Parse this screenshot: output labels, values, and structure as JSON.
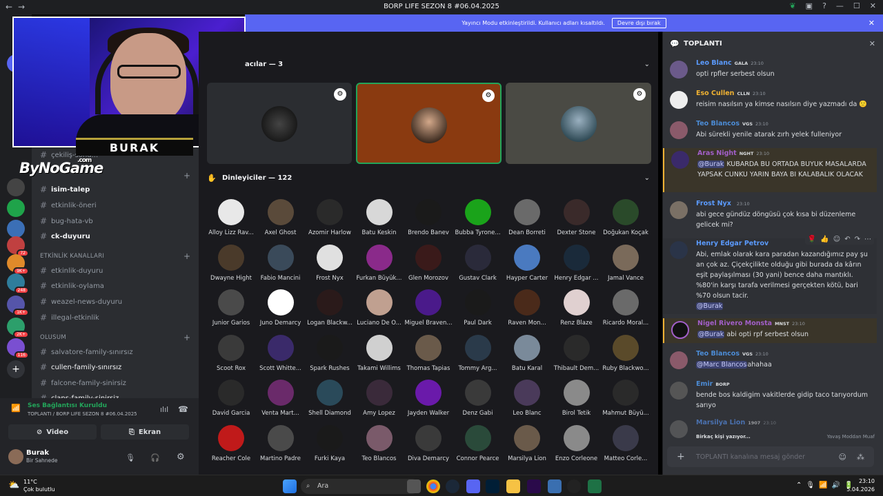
{
  "window": {
    "title": "BORP LIFE SEZON 8 #06.04.2025"
  },
  "banner": {
    "text": "Yayıncı Modu etkinleştirildi. Kullanıcı adları kısaltıldı.",
    "button": "Devre dışı bırak"
  },
  "overlay": {
    "streamer_name": "BURAK",
    "brand": "ByNoGame",
    "brand_suffix": ".com"
  },
  "servers": [
    {
      "badge": ""
    },
    {
      "badge": ""
    },
    {
      "badge": ""
    },
    {
      "badge": "72"
    },
    {
      "badge": "9K+"
    },
    {
      "badge": "248"
    },
    {
      "badge": "1K+"
    },
    {
      "badge": "2K+"
    },
    {
      "badge": "116"
    }
  ],
  "channels": {
    "top_partial": "çekiliş-sonu...",
    "items_a": [
      {
        "label": "isim-talep",
        "active": true
      },
      {
        "label": "etkinlik-öneri",
        "active": false
      },
      {
        "label": "bug-hata-vb",
        "active": false
      },
      {
        "label": "ck-duyuru",
        "active": true
      }
    ],
    "category_events": "ETKİNLİK KANALLARI",
    "items_b": [
      "etkinlik-duyuru",
      "etkinlik-oylama",
      "weazel-news-duyuru",
      "illegal-etkinlik"
    ],
    "category_olusum": "OLUSUM",
    "items_c": [
      {
        "label": "salvatore-family-sınırsız",
        "active": false
      },
      {
        "label": "cullen-family-sınırsız",
        "active": true
      },
      {
        "label": "falcone-family-sinirsiz",
        "active": false
      },
      {
        "label": "clans-family-sinirsiz",
        "active": false
      }
    ]
  },
  "voice": {
    "status": "Ses Bağlantısı Kuruldu",
    "channel": "TOPLANTI / BORP LIFE SEZON 8 #06.04.2025",
    "video": "Video",
    "screen": "Ekran",
    "user": "Burak",
    "user_status": "Bir Sahnede"
  },
  "stage": {
    "speakers_title": "Konuşmacılar — 3",
    "speakers_title_visible": "acılar — 3",
    "audience_title": "Dinleyiciler — 122",
    "audience": [
      "Alloy Lizz Rav...",
      "Axel Ghost",
      "Azomir Harlow",
      "Batu Keskin",
      "Brendo Banev",
      "Bubba Tyrone...",
      "Dean Borreti",
      "Dexter Stone",
      "Doğukan Koçak",
      "Dwayne Hight",
      "Fabio Mancini",
      "Frost Nyx",
      "Furkan Büyük...",
      "Glen Morozov",
      "Gustav Clark",
      "Hayper Carter",
      "Henry Edgar ...",
      "Jamal Vance",
      "Junior Garios",
      "Juno Demarcy",
      "Logan Blackw...",
      "Luciano De O...",
      "Miguel Braven...",
      "Paul Dark",
      "Raven Mon...",
      "Renz Blaze",
      "Ricardo Moral...",
      "Scoot Rox",
      "Scott Whitte...",
      "Spark Rushes",
      "Takami Willims",
      "Thomas Tapias",
      "Tommy Arg...",
      "Batu Karal",
      "Thibault Dem...",
      "Ruby Blackwo...",
      "David Garcia",
      "Venta Mart...",
      "Shell Diamond",
      "Amy Lopez",
      "Jayden Walker",
      "Denz Gabi",
      "Leo Blanc",
      "Birol Tetik",
      "Mahmut Büyü...",
      "Reacher Cole",
      "Martino Padre",
      "Furki Kaya",
      "Teo Blancos",
      "Diva Demarcy",
      "Connor Pearce",
      "Marsilya Lion",
      "Enzo Corleone",
      "Matteo Corle..."
    ]
  },
  "chat": {
    "title": "TOPLANTI",
    "messages": [
      {
        "name": "Leo Blanc",
        "tag": "GALA",
        "time": "23:10",
        "text": "opti rpfler serbest olsun",
        "color": "#5b9bff"
      },
      {
        "name": "Eso Cullen",
        "tag": "CLLN",
        "time": "23:10",
        "text": "reisim nasılsın ya  kimse nasılsın diye yazmadı da 🙂",
        "color": "#f0b232"
      },
      {
        "name": "Teo Blancos",
        "tag": "VGS",
        "time": "23:10",
        "text": "Abi sürekli yenile atarak zırh yelek fulleniyor",
        "color": "#4c8cd6"
      },
      {
        "name": "Aras Night",
        "tag": "NGHT",
        "time": "23:10",
        "mention": "@Burak",
        "text": "KUBARDA BU ORTADA BUYUK MASALARDA YAPSAK CUNKU YARIN BAYA BI KALABALIK OLACAK",
        "color": "#a25fc9"
      },
      {
        "name": "Frost Nyx",
        "tag": "",
        "time": "23:10",
        "text": "abi gece gündüz döngüsü çok kısa bi düzenleme gelicek mi?",
        "color": "#5b9bff"
      },
      {
        "name": "Henry Edgar Petrov",
        "tag": "",
        "time": "",
        "text": "Abi, emlak olarak kara paradan kazandığımız pay şu an çok az. Çiçekçilikte olduğu gibi burada da kârın eşit paylaşılması (30 yani) bence daha mantıklı. %80'in karşı tarafa verilmesi gerçekten kötü, bari %70 olsun tacir.",
        "mention_after": "@Burak",
        "color": "#5b9bff"
      },
      {
        "name": "Nigel Rivero Monsta",
        "tag": "MNST",
        "time": "23:10",
        "mention": "@Burak",
        "text": "abi opti rpf serbest olsun",
        "color": "#a25fc9"
      },
      {
        "name": "Teo Blancos",
        "tag": "VGS",
        "time": "23:10",
        "mention": "@Marc Blancos",
        "text": "ahahaa",
        "color": "#4c8cd6"
      },
      {
        "name": "Emir",
        "tag": "BORP",
        "time": "",
        "text": "bende bos kaldigim vakitlerde gidip taco tarıyordum sarıyo",
        "color": "#4c8cd6"
      },
      {
        "name": "Marsilya Lion",
        "tag": "1907",
        "time": "23:10",
        "text": "",
        "color": "#5b9bff"
      }
    ],
    "typing": "Birkaç kişi yazıyor...",
    "slowmode": "Yavaş Moddan Muaf",
    "placeholder": "TOPLANTI kanalına mesaj gönder"
  },
  "taskbar": {
    "temp": "11°C",
    "weather": "Çok bulutlu",
    "search": "Ara",
    "time": "23:10",
    "date": "5.04.2026"
  }
}
